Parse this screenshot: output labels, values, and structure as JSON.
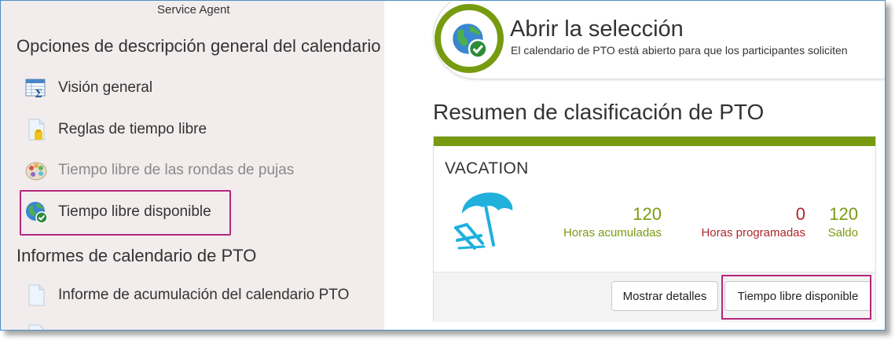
{
  "left_panel": {
    "top_label": "Service Agent",
    "overview_section_title": "Opciones de descripción general del calendario",
    "overview_items": [
      {
        "label": "Visión general",
        "icon": "table-summary-icon",
        "enabled": true
      },
      {
        "label": "Reglas de tiempo libre",
        "icon": "document-rules-icon",
        "enabled": true
      },
      {
        "label": "Tiempo libre de las rondas de pujas",
        "icon": "palette-icon",
        "enabled": false
      },
      {
        "label": "Tiempo libre disponible",
        "icon": "globe-check-icon",
        "enabled": true,
        "highlighted": true
      }
    ],
    "reports_section_title": "Informes de calendario de PTO",
    "report_items": [
      {
        "label": "Informe de acumulación del calendario PTO",
        "icon": "document-icon"
      }
    ]
  },
  "selection": {
    "title": "Abrir la selección",
    "subtitle": "El calendario de PTO está abierto para que los participantes soliciten",
    "icon": "globe-check-icon"
  },
  "summary": {
    "title": "Resumen de clasificación de PTO",
    "card": {
      "code": "VACATION",
      "icon": "beach-chair-umbrella-icon",
      "stats": [
        {
          "value": "120",
          "label": "Horas acumuladas",
          "color": "#7a9a10"
        },
        {
          "value": "0",
          "label": "Horas programadas",
          "color": "#b0262d"
        },
        {
          "value": "120",
          "label": "Saldo",
          "color": "#7a9a10"
        }
      ],
      "buttons": {
        "details": "Mostrar detalles",
        "available": "Tiempo libre disponible"
      }
    }
  },
  "colors": {
    "accent_green": "#779b10",
    "highlight_magenta": "#b5267f",
    "left_panel_bg": "#f2ecec"
  }
}
